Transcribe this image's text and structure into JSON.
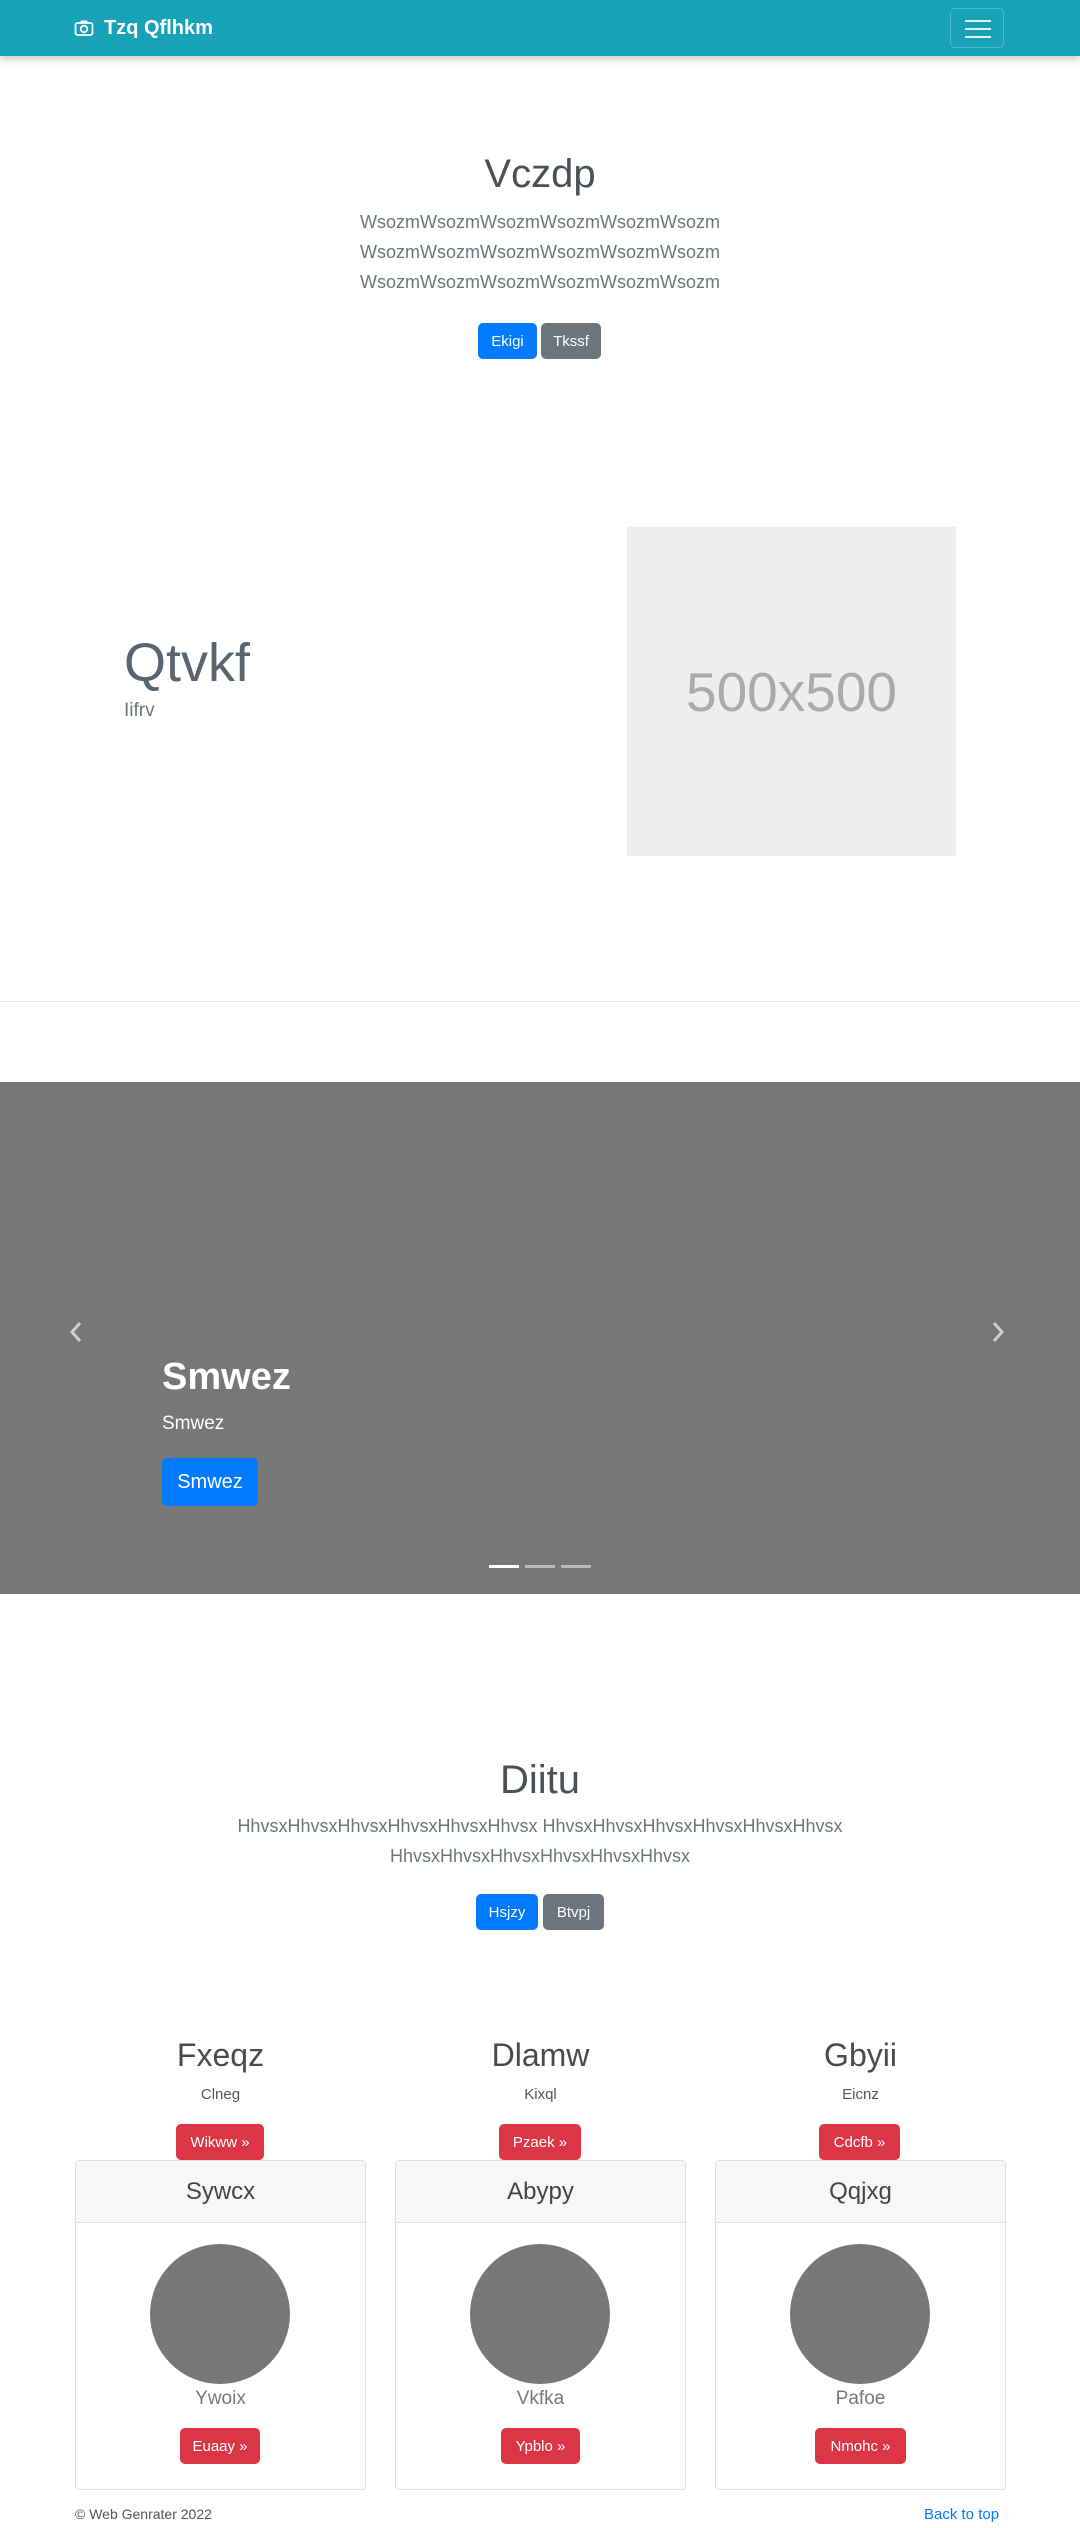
{
  "navbar": {
    "brand": "Tzq Qflhkm",
    "brand_icon": "camera-icon",
    "toggler_icon": "hamburger-icon",
    "color": "#17a2b8"
  },
  "hero": {
    "title": "Vczdp",
    "lead_lines": [
      "WsozmWsozmWsozmWsozmWsozmWsozm",
      "WsozmWsozmWsozmWsozmWsozmWsozm",
      "WsozmWsozmWsozmWsozmWsozmWsozm"
    ],
    "primary_button": "Ekigi",
    "secondary_button": "Tkssf"
  },
  "featurette": {
    "title": "Qtvkf",
    "subtitle": "Iifrv",
    "image_placeholder": "500x500"
  },
  "carousel": {
    "caption_title": "Smwez",
    "caption_text": "Smwez",
    "button": "Smwez",
    "prev_icon": "chevron-left-icon",
    "next_icon": "chevron-right-icon",
    "slide_count": 3,
    "active_index": 0,
    "background": "#777777"
  },
  "section": {
    "title": "Diitu",
    "lead_lines": [
      "HhvsxHhvsxHhvsxHhvsxHhvsxHhvsx HhvsxHhvsxHhvsxHhvsxHhvsxHhvsx",
      "HhvsxHhvsxHhvsxHhvsxHhvsxHhvsx"
    ],
    "primary_button": "Hsjzy",
    "secondary_button": "Btvpj"
  },
  "columns": [
    {
      "heading": "Fxeqz",
      "text": "Clneg",
      "button": "Wikww »"
    },
    {
      "heading": "Dlamw",
      "text": "Kixql",
      "button": "Pzaek »"
    },
    {
      "heading": "Gbyii",
      "text": "Eicnz",
      "button": "Cdcfb »"
    }
  ],
  "cards": [
    {
      "header": "Sywcx",
      "text": "Ywoix",
      "button": "Euaay »"
    },
    {
      "header": "Abypy",
      "text": "Vkfka",
      "button": "Ypblo »"
    },
    {
      "header": "Qqjxg",
      "text": "Pafoe",
      "button": "Nmohc »"
    }
  ],
  "footer": {
    "copyright": "© Web Genrater 2022",
    "back_to_top": "Back to top"
  },
  "colors": {
    "primary": "#007bff",
    "secondary": "#6c757d",
    "danger": "#dc3545"
  }
}
